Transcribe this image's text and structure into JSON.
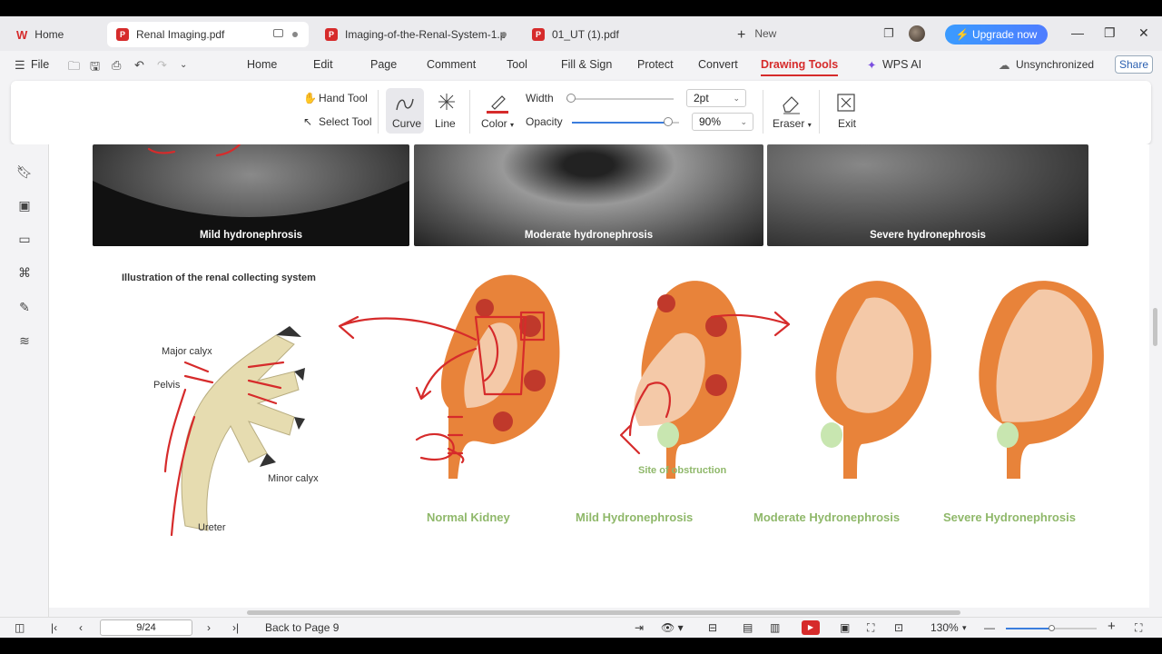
{
  "tabs": {
    "home": "Home",
    "renal": "Renal Imaging.pdf",
    "imaging": "Imaging-of-the-Renal-System-1.p",
    "ut": "01_UT (1).pdf",
    "new": "New"
  },
  "header": {
    "upgrade": "⚡ Upgrade now"
  },
  "menu": {
    "file": "File",
    "home": "Home",
    "edit": "Edit",
    "page": "Page",
    "comment": "Comment",
    "tool": "Tool",
    "fill_sign": "Fill & Sign",
    "protect": "Protect",
    "convert": "Convert",
    "drawing_tools": "Drawing Tools",
    "wps_ai": "WPS AI",
    "unsync": "Unsynchronized",
    "share": "Share"
  },
  "ribbon": {
    "hand_tool": "Hand Tool",
    "select_tool": "Select Tool",
    "curve": "Curve",
    "line": "Line",
    "color": "Color",
    "width_label": "Width",
    "width_value": "2pt",
    "opacity_label": "Opacity",
    "opacity_value": "90%",
    "eraser": "Eraser",
    "exit": "Exit",
    "ink_color": "#d62b2b",
    "opacity_level": 0.9
  },
  "doc": {
    "us_captions": [
      "Mild hydronephrosis",
      "Moderate hydronephrosis",
      "Severe hydronephrosis"
    ],
    "illustration_title": "Illustration of the renal collecting system",
    "anatomy": {
      "major_calyx": "Major calyx",
      "pelvis": "Pelvis",
      "minor_calyx": "Minor calyx",
      "ureter": "Ureter"
    },
    "site_of_obstruction": "Site of obstruction",
    "stages": [
      "Normal Kidney",
      "Mild Hydronephrosis",
      "Moderate Hydronephrosis",
      "Severe Hydronephrosis"
    ]
  },
  "status": {
    "page": "9/24",
    "back": "Back to Page 9",
    "zoom": "130%"
  }
}
